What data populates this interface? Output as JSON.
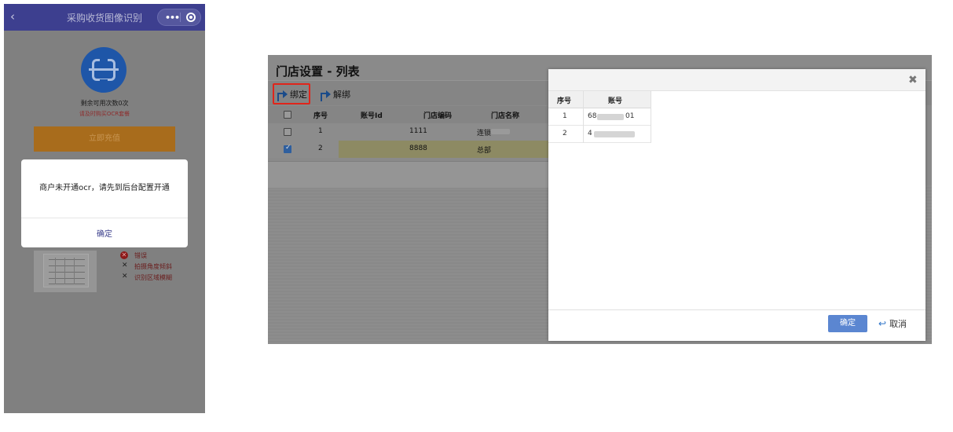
{
  "phone": {
    "title": "采购收货图像识别",
    "back_icon": "‹",
    "menu_icon": "•••",
    "remaining_label": "剩余可用次数0次",
    "reminder_label": "请及时购买OCR套餐",
    "recharge_label": "立即充值",
    "dialog_message": "商户未开通ocr，请先到后台配置开通",
    "dialog_confirm": "确定",
    "legend": [
      {
        "icon": "error-icon",
        "label": "错误"
      },
      {
        "icon": "x-icon",
        "label": "拍摄角度倾斜"
      },
      {
        "icon": "x-icon",
        "label": "识别区域模糊"
      }
    ]
  },
  "admin": {
    "panel_title": "门店设置 - 列表",
    "toolbar": {
      "bind_label": "绑定",
      "unbind_label": "解绑"
    },
    "grid": {
      "headers": [
        "序号",
        "账号Id",
        "门店编码",
        "门店名称"
      ],
      "rows": [
        {
          "index": "1",
          "account_id": "",
          "store_code": "1111",
          "store_name": "连锁",
          "checked": false
        },
        {
          "index": "2",
          "account_id": "",
          "store_code": "8888",
          "store_name": "总部",
          "checked": true
        }
      ]
    },
    "modal": {
      "close_icon": "✖",
      "headers": [
        "序号",
        "账号"
      ],
      "rows": [
        {
          "index": "1",
          "account_prefix": "68",
          "account_suffix": "01"
        },
        {
          "index": "2",
          "account_prefix": "4",
          "account_suffix": ""
        }
      ],
      "confirm_label": "确定",
      "cancel_label": "取消",
      "cancel_icon": "↩"
    }
  },
  "colors": {
    "phone_nav": "#3d3f8f",
    "scan_circle": "#1e56a8",
    "recharge": "#a86c1c",
    "highlight_border": "#e0251b",
    "selected_row": "#8d8a63",
    "confirm_button": "#5b86d1"
  }
}
